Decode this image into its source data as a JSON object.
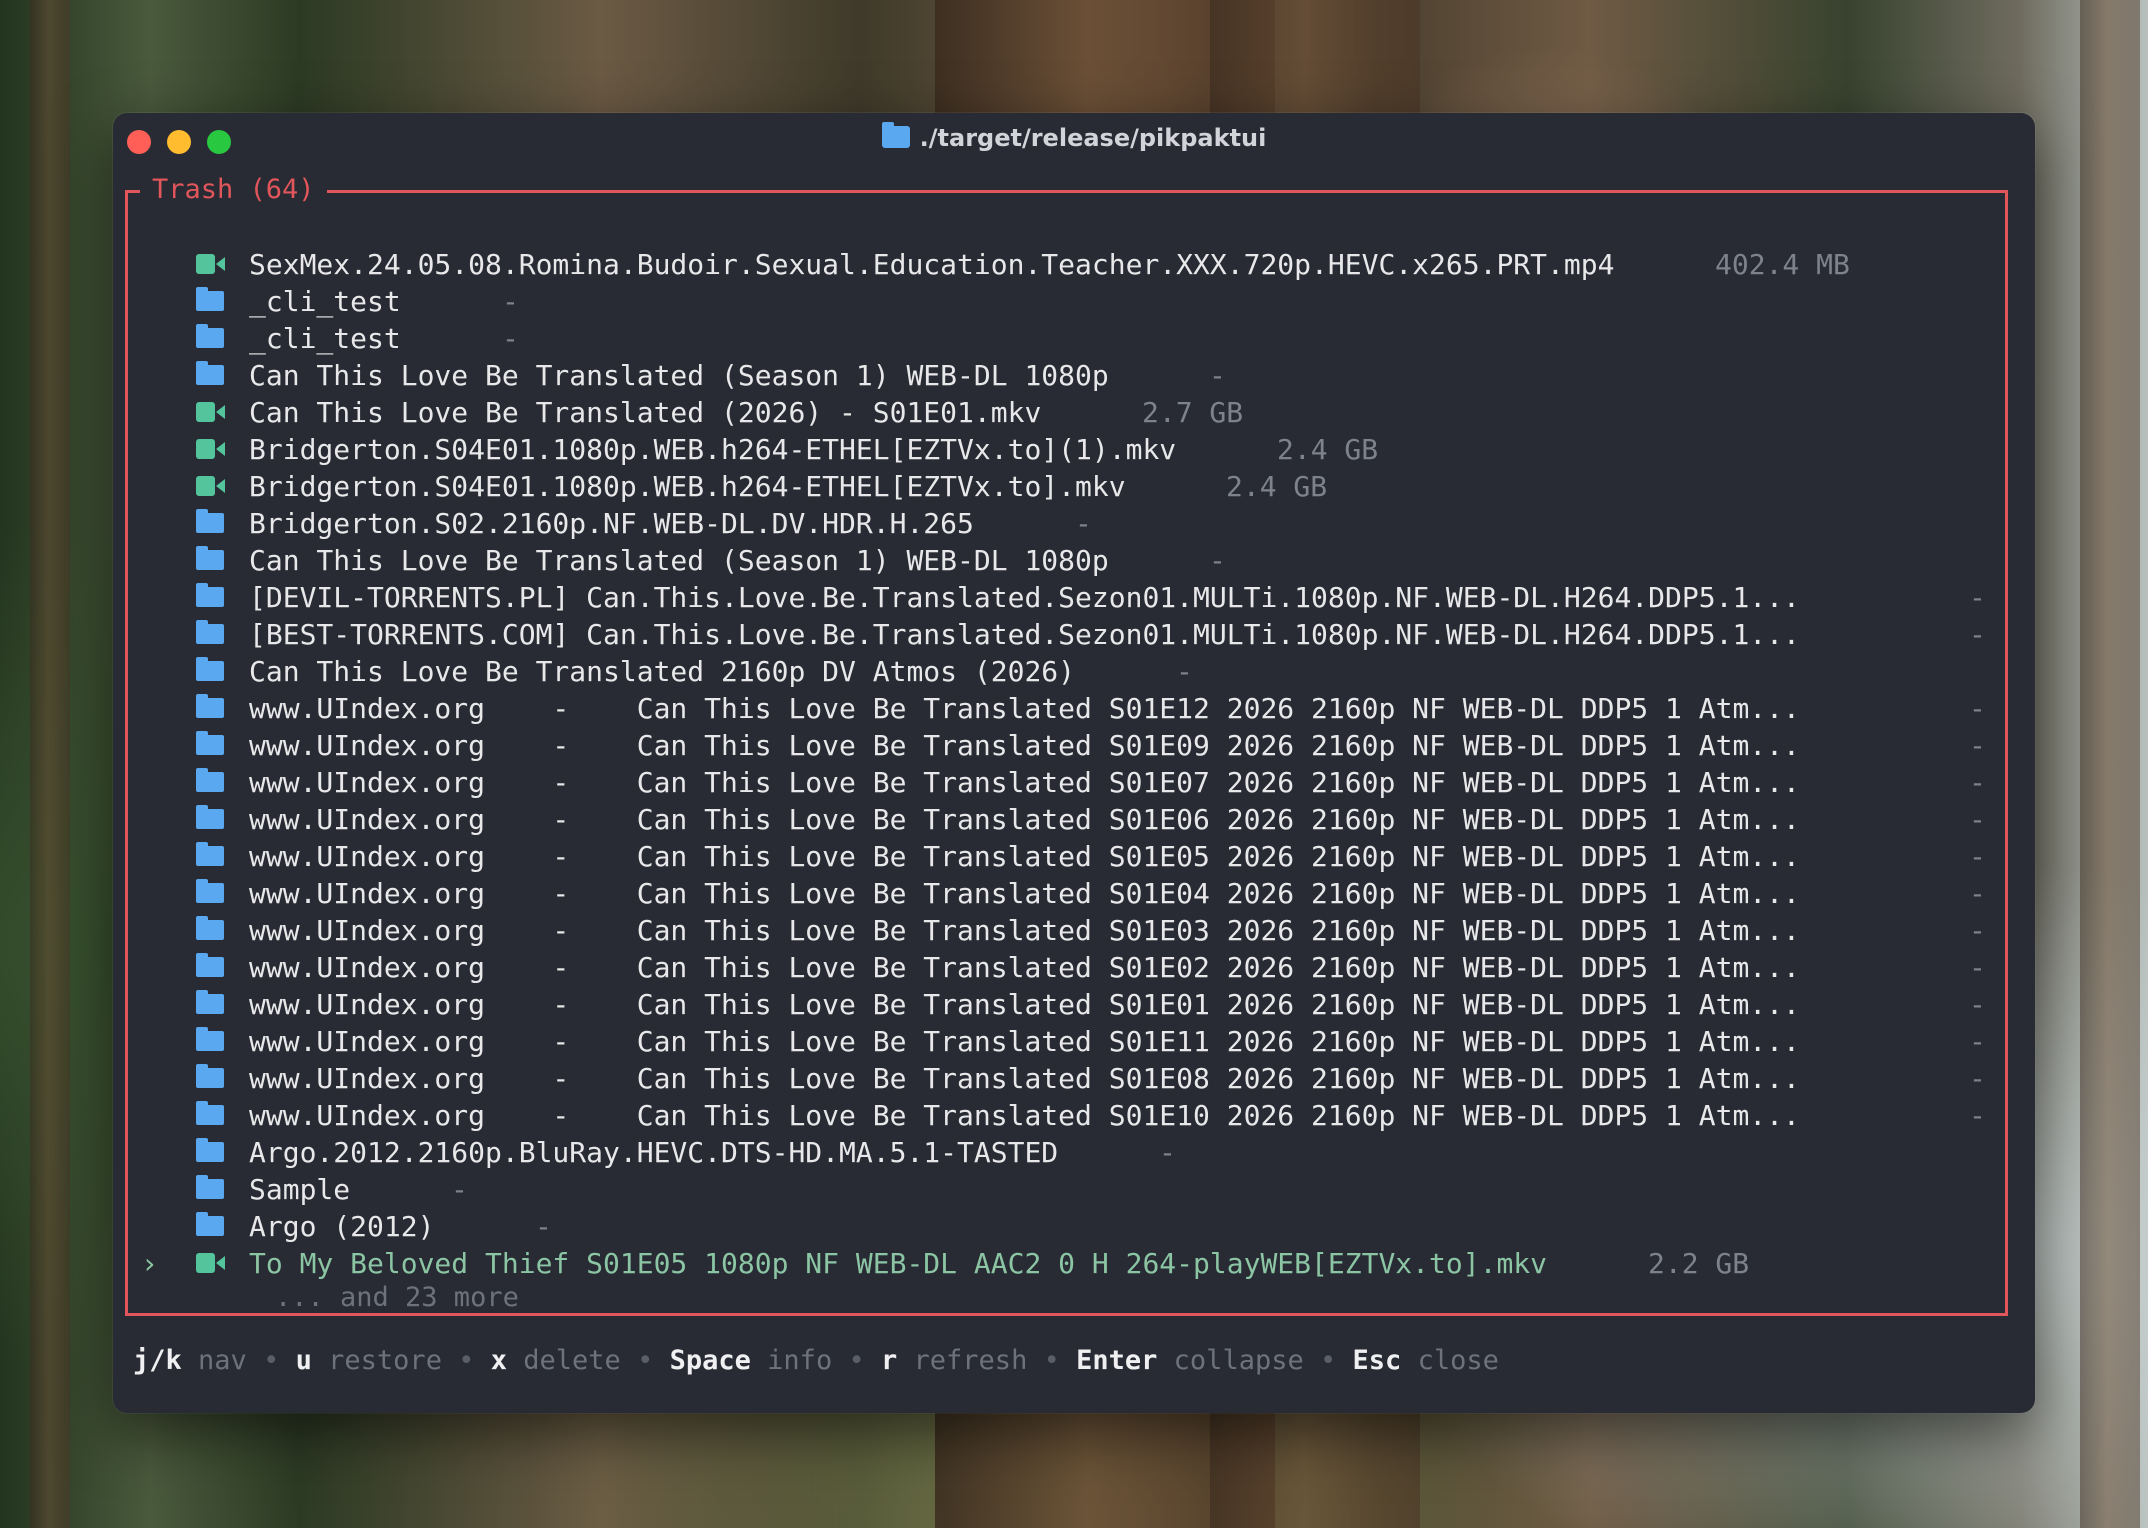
{
  "window": {
    "title": "./target/release/pikpaktui"
  },
  "panel": {
    "title": "Trash (64)"
  },
  "items": [
    {
      "icon": "video",
      "name": "SexMex.24.05.08.Romina.Budoir.Sexual.Education.Teacher.XXX.720p.HEVC.x265.PRT.mp4",
      "size": "402.4 MB"
    },
    {
      "icon": "folder",
      "name": "_cli_test",
      "size": "-"
    },
    {
      "icon": "folder",
      "name": "_cli_test",
      "size": "-"
    },
    {
      "icon": "folder",
      "name": "Can This Love Be Translated (Season 1) WEB-DL 1080p",
      "size": "-"
    },
    {
      "icon": "video",
      "name": "Can This Love Be Translated (2026) - S01E01.mkv",
      "size": "2.7 GB"
    },
    {
      "icon": "video",
      "name": "Bridgerton.S04E01.1080p.WEB.h264-ETHEL[EZTVx.to](1).mkv",
      "size": "2.4 GB"
    },
    {
      "icon": "video",
      "name": "Bridgerton.S04E01.1080p.WEB.h264-ETHEL[EZTVx.to].mkv",
      "size": "2.4 GB"
    },
    {
      "icon": "folder",
      "name": "Bridgerton.S02.2160p.NF.WEB-DL.DV.HDR.H.265",
      "size": "-"
    },
    {
      "icon": "folder",
      "name": "Can This Love Be Translated (Season 1) WEB-DL 1080p",
      "size": "-"
    },
    {
      "icon": "folder",
      "name": "[DEVIL-TORRENTS.PL] Can.This.Love.Be.Translated.Sezon01.MULTi.1080p.NF.WEB-DL.H264.DDP5.1...",
      "size": "-"
    },
    {
      "icon": "folder",
      "name": "[BEST-TORRENTS.COM] Can.This.Love.Be.Translated.Sezon01.MULTi.1080p.NF.WEB-DL.H264.DDP5.1...",
      "size": "-"
    },
    {
      "icon": "folder",
      "name": "Can This Love Be Translated 2160p DV Atmos (2026)",
      "size": "-"
    },
    {
      "icon": "folder",
      "name": "www.UIndex.org    -    Can This Love Be Translated S01E12 2026 2160p NF WEB-DL DDP5 1 Atm...",
      "size": "-"
    },
    {
      "icon": "folder",
      "name": "www.UIndex.org    -    Can This Love Be Translated S01E09 2026 2160p NF WEB-DL DDP5 1 Atm...",
      "size": "-"
    },
    {
      "icon": "folder",
      "name": "www.UIndex.org    -    Can This Love Be Translated S01E07 2026 2160p NF WEB-DL DDP5 1 Atm...",
      "size": "-"
    },
    {
      "icon": "folder",
      "name": "www.UIndex.org    -    Can This Love Be Translated S01E06 2026 2160p NF WEB-DL DDP5 1 Atm...",
      "size": "-"
    },
    {
      "icon": "folder",
      "name": "www.UIndex.org    -    Can This Love Be Translated S01E05 2026 2160p NF WEB-DL DDP5 1 Atm...",
      "size": "-"
    },
    {
      "icon": "folder",
      "name": "www.UIndex.org    -    Can This Love Be Translated S01E04 2026 2160p NF WEB-DL DDP5 1 Atm...",
      "size": "-"
    },
    {
      "icon": "folder",
      "name": "www.UIndex.org    -    Can This Love Be Translated S01E03 2026 2160p NF WEB-DL DDP5 1 Atm...",
      "size": "-"
    },
    {
      "icon": "folder",
      "name": "www.UIndex.org    -    Can This Love Be Translated S01E02 2026 2160p NF WEB-DL DDP5 1 Atm...",
      "size": "-"
    },
    {
      "icon": "folder",
      "name": "www.UIndex.org    -    Can This Love Be Translated S01E01 2026 2160p NF WEB-DL DDP5 1 Atm...",
      "size": "-"
    },
    {
      "icon": "folder",
      "name": "www.UIndex.org    -    Can This Love Be Translated S01E11 2026 2160p NF WEB-DL DDP5 1 Atm...",
      "size": "-"
    },
    {
      "icon": "folder",
      "name": "www.UIndex.org    -    Can This Love Be Translated S01E08 2026 2160p NF WEB-DL DDP5 1 Atm...",
      "size": "-"
    },
    {
      "icon": "folder",
      "name": "www.UIndex.org    -    Can This Love Be Translated S01E10 2026 2160p NF WEB-DL DDP5 1 Atm...",
      "size": "-"
    },
    {
      "icon": "folder",
      "name": "Argo.2012.2160p.BluRay.HEVC.DTS-HD.MA.5.1-TASTED",
      "size": "-"
    },
    {
      "icon": "folder",
      "name": "Sample",
      "size": "-"
    },
    {
      "icon": "folder",
      "name": "Argo (2012)",
      "size": "-"
    },
    {
      "icon": "video",
      "name": "To My Beloved Thief S01E05 1080p NF WEB-DL AAC2 0 H 264-playWEB[EZTVx.to].mkv",
      "size": "2.2 GB",
      "selected": true,
      "marker": "›"
    }
  ],
  "more_text": "... and 23 more",
  "status_bar": [
    {
      "key": "j/k",
      "desc": "nav"
    },
    {
      "key": "u",
      "desc": "restore"
    },
    {
      "key": "x",
      "desc": "delete"
    },
    {
      "key": "Space",
      "desc": "info"
    },
    {
      "key": "r",
      "desc": "refresh"
    },
    {
      "key": "Enter",
      "desc": "collapse"
    },
    {
      "key": "Esc",
      "desc": "close"
    }
  ],
  "separator": "•",
  "colors": {
    "accent_red": "#e0565b",
    "selected_green": "#8bc5a4",
    "folder_blue": "#5aa9f0",
    "video_green": "#54c49c",
    "background": "#282b33"
  }
}
